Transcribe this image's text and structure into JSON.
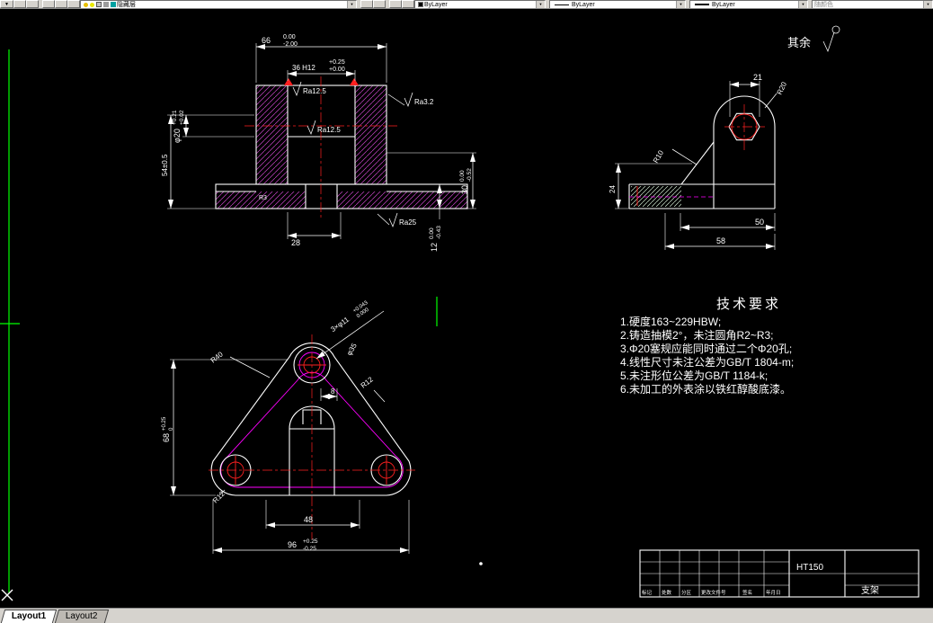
{
  "glyphs": {
    "dropdown_arrow": "▼"
  },
  "toolbar": {
    "layer_combo": {
      "label": "隐藏层"
    },
    "color_combo": {
      "label": "ByLayer",
      "swatch_color": "#000000"
    },
    "linetype_combo": {
      "label": "ByLayer"
    },
    "lineweight_combo": {
      "label": "ByLayer"
    },
    "plotstyle_combo": {
      "label": "随颜色"
    }
  },
  "tabs": {
    "layout1": "Layout1",
    "layout2": "Layout2"
  },
  "general_note": {
    "text": "其余"
  },
  "front_view": {
    "dim_66": "66",
    "dim_66_tol_top": "0.00",
    "dim_66_tol_bot": "-2.00",
    "dim_36": "36 H12",
    "dim_36_tol_top": "+0.25",
    "dim_36_tol_bot": "+0.00",
    "ra_top": "Ra12.5",
    "ra_right": "Ra3.2",
    "ra_inner": "Ra12.5",
    "ra_bottom": "Ra25",
    "dim_phi20": "φ20",
    "dim_phi20_tol_top": "+0.21",
    "dim_phi20_tol_bot": "+0.02",
    "dim_54": "54±0.5",
    "dim_30": "30",
    "dim_30_tol_top": "0.00",
    "dim_30_tol_bot": "-0.52",
    "dim_12": "12",
    "dim_12_tol_top": "0.00",
    "dim_12_tol_bot": "-0.43",
    "dim_28": "28",
    "r3": "R3"
  },
  "side_view": {
    "dim_21": "21",
    "r20": "R20",
    "r10": "R10",
    "dim_24": "24",
    "dim_50": "50",
    "dim_58": "58"
  },
  "plan_view": {
    "dim_3xphi11": "3×φ11",
    "dim_3xphi11_tol_top": "+0.043",
    "dim_3xphi11_tol_bot": "0.000",
    "phi35": "φ35",
    "r40": "R40",
    "r12_right": "R12",
    "r12_left": "R12",
    "dim_8": "8",
    "dim_68": "68",
    "dim_68_tol_top": "+0.25",
    "dim_68_tol_bot": "0",
    "dim_48": "48",
    "dim_96": "96",
    "dim_96_tol_top": "+0.25",
    "dim_96_tol_bot": "-0.25"
  },
  "tech_requirements": {
    "title": "技术要求",
    "items": [
      "1.硬度163~229HBW;",
      "2.铸造抽模2°，未注圆角R2~R3;",
      "3.Φ20塞规应能同时通过二个Φ20孔;",
      "4.线性尺寸未注公差为GB/T 1804-m;",
      "5.未注形位公差为GB/T 1184-k;",
      "6.未加工的外表涂以铁红醇酸底漆。"
    ]
  },
  "title_block": {
    "material": "HT150",
    "part_name": "支架",
    "row_labels": [
      "标记",
      "处数",
      "分区",
      "更改文件号",
      "签名",
      "年月日"
    ]
  },
  "colors": {
    "canvas_bg": "#000000",
    "line_white": "#ffffff",
    "line_magenta": "#ff00ff",
    "line_red": "#ff2020",
    "crosshair_green": "#00ff00",
    "chrome_bg": "#d6d3ce"
  }
}
